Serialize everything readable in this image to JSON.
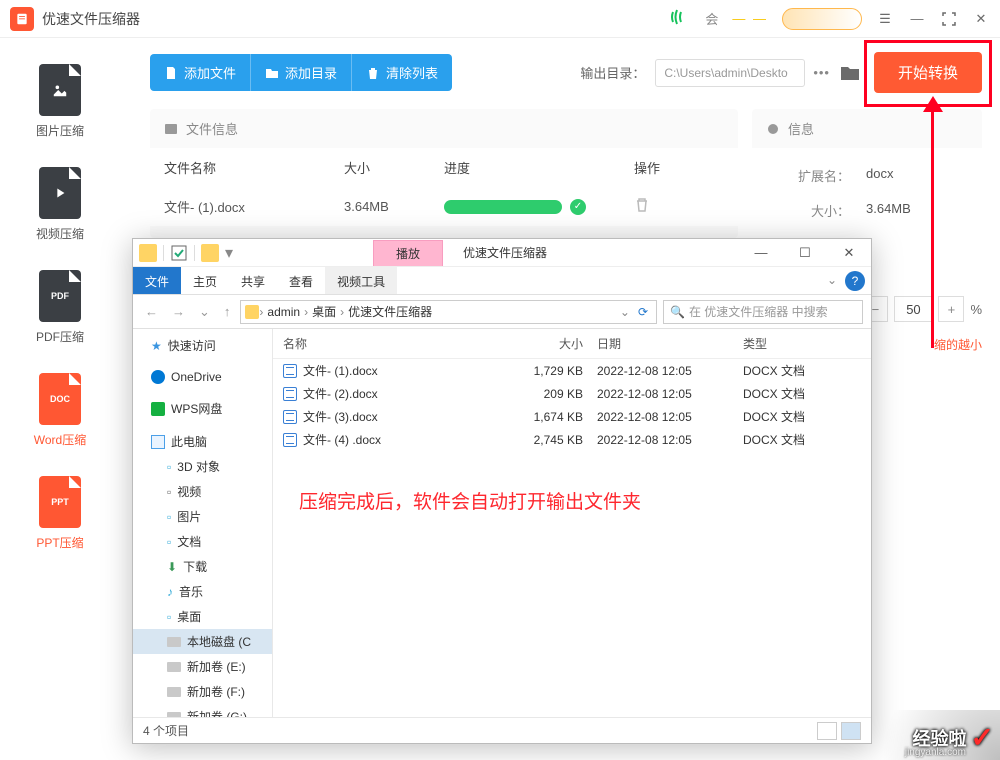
{
  "app": {
    "name": "优速文件压缩器"
  },
  "titlebar": {
    "s": "会"
  },
  "sidebar": [
    {
      "label": "图片压缩",
      "color": "dark",
      "active": false
    },
    {
      "label": "视频压缩",
      "color": "dark",
      "active": false
    },
    {
      "label": "PDF压缩",
      "color": "dark",
      "badge": "PDF",
      "active": false
    },
    {
      "label": "Word压缩",
      "color": "red",
      "badge": "DOC",
      "active": true
    },
    {
      "label": "PPT压缩",
      "color": "red",
      "badge": "PPT",
      "active": true
    }
  ],
  "toolbar": {
    "add_file": "添加文件",
    "add_dir": "添加目录",
    "clear": "清除列表",
    "output_label": "输出目录：",
    "output_path": "C:\\Users\\admin\\Deskto",
    "start": "开始转换"
  },
  "filepanel": {
    "title": "文件信息",
    "cols": {
      "name": "文件名称",
      "size": "大小",
      "progress": "进度",
      "action": "操作"
    },
    "row": {
      "name": "文件- (1).docx",
      "size": "3.64MB"
    }
  },
  "infopanel": {
    "title": "信息",
    "ext_k": "扩展名：",
    "ext_v": "docx",
    "size_k": "大小：",
    "size_v": "3.64MB"
  },
  "percent": {
    "value": "50",
    "unit": "%"
  },
  "small_note": "缩的越小",
  "explorer": {
    "play_tab": "播放",
    "app_name": "优速文件压缩器",
    "tabs": {
      "file": "文件",
      "home": "主页",
      "share": "共享",
      "view": "查看",
      "video": "视频工具"
    },
    "path": [
      "admin",
      "桌面",
      "优速文件压缩器"
    ],
    "search_placeholder": "在 优速文件压缩器 中搜索",
    "side": {
      "quick": "快速访问",
      "onedrive": "OneDrive",
      "wps": "WPS网盘",
      "pc": "此电脑",
      "d3": "3D 对象",
      "video": "视频",
      "pic": "图片",
      "doc": "文档",
      "dl": "下载",
      "music": "音乐",
      "desktop": "桌面",
      "localc": "本地磁盘 (C",
      "e": "新加卷 (E:)",
      "f": "新加卷 (F:)",
      "g": "新加卷 (G:)"
    },
    "cols": {
      "name": "名称",
      "size": "大小",
      "date": "日期",
      "type": "类型"
    },
    "rows": [
      {
        "name": "文件- (1).docx",
        "size": "1,729 KB",
        "date": "2022-12-08 12:05",
        "type": "DOCX 文档"
      },
      {
        "name": "文件- (2).docx",
        "size": "209 KB",
        "date": "2022-12-08 12:05",
        "type": "DOCX 文档"
      },
      {
        "name": "文件- (3).docx",
        "size": "1,674 KB",
        "date": "2022-12-08 12:05",
        "type": "DOCX 文档"
      },
      {
        "name": "文件- (4) .docx",
        "size": "2,745 KB",
        "date": "2022-12-08 12:05",
        "type": "DOCX 文档"
      }
    ],
    "annotation": "压缩完成后，软件会自动打开输出文件夹",
    "status": "4 个项目"
  },
  "watermark": {
    "main": "经验啦",
    "sub": "jingyanla.com"
  }
}
